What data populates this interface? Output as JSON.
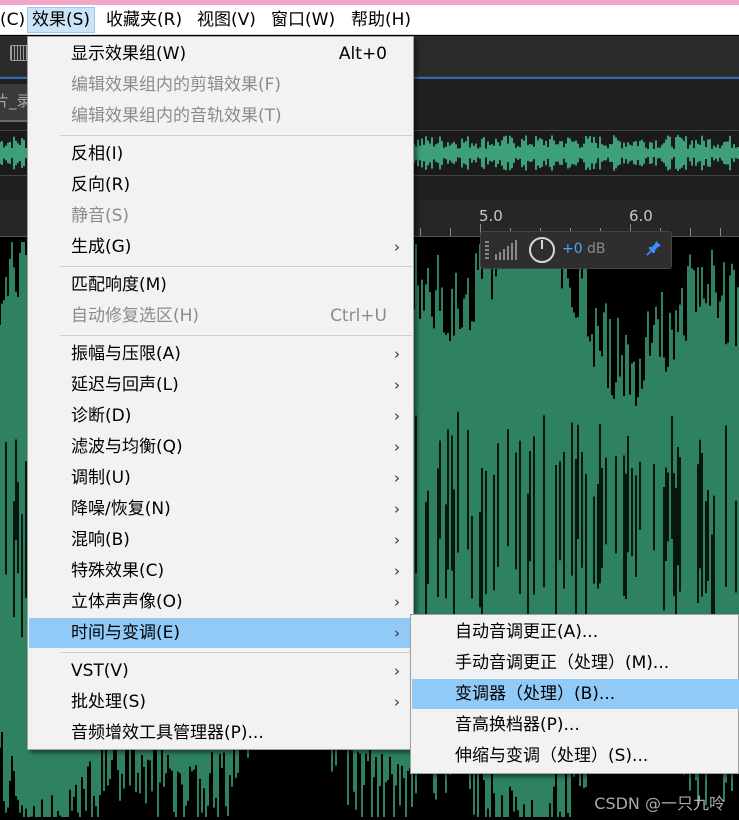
{
  "menubar": {
    "items": [
      {
        "label": "(C)"
      },
      {
        "label": "效果(S)"
      },
      {
        "label": "收藏夹(R)"
      },
      {
        "label": "视图(V)"
      },
      {
        "label": "窗口(W)"
      },
      {
        "label": "帮助(H)"
      }
    ]
  },
  "editor": {
    "clip_tab_label": "片_录",
    "ruler": {
      "tick_labels": [
        "5.0",
        "6.0"
      ]
    },
    "hud": {
      "gain_value": "+0",
      "gain_unit": "dB"
    },
    "waveform_color": "#4dd9a0"
  },
  "effects_menu": {
    "items": [
      {
        "label": "显示效果组(W)",
        "shortcut": "Alt+0",
        "enabled": true,
        "submenu": false
      },
      {
        "label": "编辑效果组内的剪辑效果(F)",
        "enabled": false,
        "submenu": false
      },
      {
        "label": "编辑效果组内的音轨效果(T)",
        "enabled": false,
        "submenu": false
      },
      {
        "label": "反相(I)",
        "enabled": true,
        "submenu": false
      },
      {
        "label": "反向(R)",
        "enabled": true,
        "submenu": false
      },
      {
        "label": "静音(S)",
        "enabled": false,
        "submenu": false
      },
      {
        "label": "生成(G)",
        "enabled": true,
        "submenu": true
      },
      {
        "label": "匹配响度(M)",
        "enabled": true,
        "submenu": false
      },
      {
        "label": "自动修复选区(H)",
        "shortcut": "Ctrl+U",
        "enabled": false,
        "submenu": false
      },
      {
        "label": "振幅与压限(A)",
        "enabled": true,
        "submenu": true
      },
      {
        "label": "延迟与回声(L)",
        "enabled": true,
        "submenu": true
      },
      {
        "label": "诊断(D)",
        "enabled": true,
        "submenu": true
      },
      {
        "label": "滤波与均衡(Q)",
        "enabled": true,
        "submenu": true
      },
      {
        "label": "调制(U)",
        "enabled": true,
        "submenu": true
      },
      {
        "label": "降噪/恢复(N)",
        "enabled": true,
        "submenu": true
      },
      {
        "label": "混响(B)",
        "enabled": true,
        "submenu": true
      },
      {
        "label": "特殊效果(C)",
        "enabled": true,
        "submenu": true
      },
      {
        "label": "立体声声像(O)",
        "enabled": true,
        "submenu": true
      },
      {
        "label": "时间与变调(E)",
        "enabled": true,
        "submenu": true,
        "highlighted": true
      },
      {
        "label": "VST(V)",
        "enabled": true,
        "submenu": true
      },
      {
        "label": "批处理(S)",
        "enabled": true,
        "submenu": true
      },
      {
        "label": "音频增效工具管理器(P)...",
        "enabled": true,
        "submenu": false
      }
    ]
  },
  "time_pitch_submenu": {
    "items": [
      {
        "label": "自动音调更正(A)..."
      },
      {
        "label": "手动音调更正（处理）(M)..."
      },
      {
        "label": "变调器（处理）(B)...",
        "highlighted": true
      },
      {
        "label": "音高换档器(P)..."
      },
      {
        "label": "伸缩与变调（处理）(S)..."
      }
    ]
  },
  "watermark": "CSDN @一只九呤",
  "colors": {
    "highlight": "#91c9f7",
    "menu_bg": "#f2f2f2",
    "accent": "#2d6cb5"
  }
}
